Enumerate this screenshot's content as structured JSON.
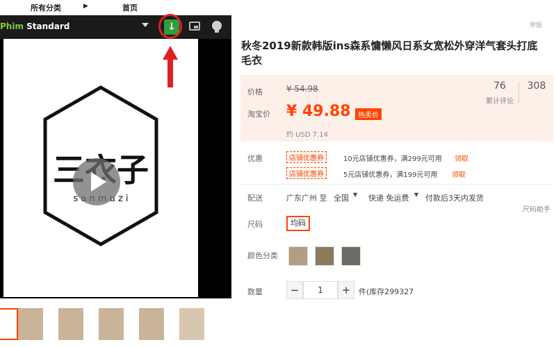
{
  "nav": {
    "category": "所有分类",
    "home": "首页"
  },
  "player": {
    "title_prefix": "Phim",
    "title": "Standard",
    "logo_main": "三衣子",
    "logo_sub": "s a n m u z i",
    "icons": [
      "download-icon",
      "pip-icon",
      "bulb-icon",
      "play-icon"
    ]
  },
  "product": {
    "report": "举报",
    "title": "秋冬2019新款韩版ins森系慵懒风日系女宽松外穿洋气套头打底毛衣",
    "price_label": "价格",
    "original_price": "¥ 54.98",
    "taobao_label": "淘宝价",
    "current_price": "¥ 49.88",
    "promo_tag": "热卖价",
    "usd": "约 USD 7.14",
    "reviews_count": "76",
    "reviews_label": "累计评论",
    "sales_count": "308",
    "coupon_label": "优惠",
    "coupons": [
      {
        "tag": "店铺优惠券",
        "text": "10元店铺优惠券，满299元可用",
        "link": "领取"
      },
      {
        "tag": "店铺优惠券",
        "text": "5元店铺优惠券，满199元可用",
        "link": "领取"
      }
    ],
    "shipping_label": "配送",
    "shipping_from": "广东广州 至",
    "shipping_dest": "全国",
    "shipping_type": "快递 免运费",
    "shipping_time": "付款后3天内发货",
    "size_assistant": "尺码助手",
    "size_label": "尺码",
    "size_value": "均码",
    "color_label": "颜色分类",
    "qty_label": "数量",
    "qty_minus": "−",
    "qty_value": "1",
    "qty_plus": "+",
    "stock": "件(库存299327"
  },
  "colors": {
    "accent": "#ff4400",
    "download_green": "#2e9e3a",
    "annotation_red": "#e02020"
  }
}
